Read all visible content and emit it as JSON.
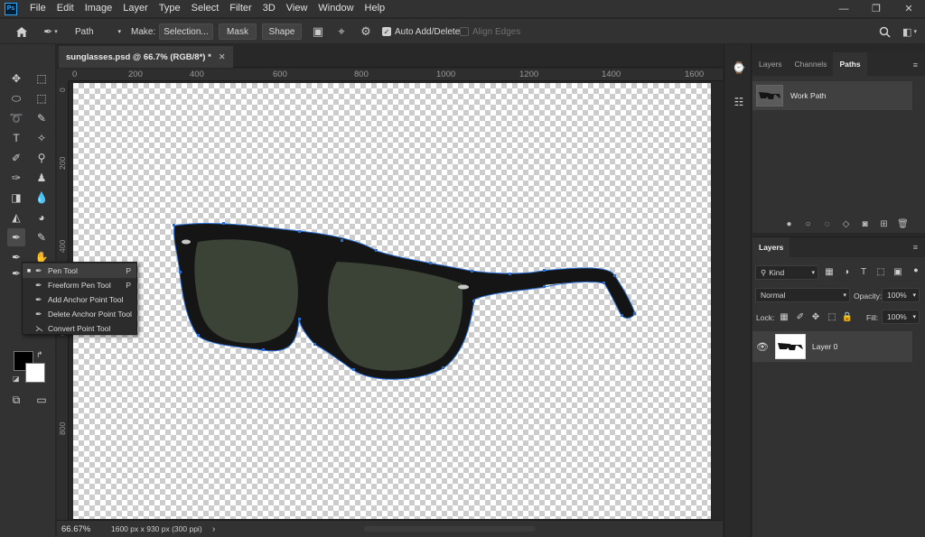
{
  "app": {
    "logo_text": "Ps"
  },
  "menu": [
    "File",
    "Edit",
    "Image",
    "Layer",
    "Type",
    "Select",
    "Filter",
    "3D",
    "View",
    "Window",
    "Help"
  ],
  "window_controls": {
    "minimize": "—",
    "restore": "❐",
    "close": "✕"
  },
  "options_bar": {
    "mode_value": "Path",
    "make_label": "Make:",
    "selection_button": "Selection...",
    "mask_button": "Mask",
    "shape_button": "Shape",
    "auto_add_delete_label": "Auto Add/Delete",
    "auto_add_delete_checked": true,
    "align_edges_label": "Align Edges",
    "align_edges_checked": false
  },
  "document": {
    "tab_title": "sunglasses.psd @ 66.7% (RGB/8*) *",
    "close_glyph": "✕",
    "ruler_top": [
      "0",
      "200",
      "400",
      "600",
      "800",
      "1000",
      "1200",
      "1400",
      "1600"
    ],
    "ruler_left": [
      "0",
      "200",
      "400",
      "600",
      "800"
    ]
  },
  "tool_flyout": {
    "items": [
      {
        "label": "Pen Tool",
        "shortcut": "P",
        "selected": true
      },
      {
        "label": "Freeform Pen Tool",
        "shortcut": "P",
        "selected": false
      },
      {
        "label": "Add Anchor Point Tool",
        "shortcut": "",
        "selected": false
      },
      {
        "label": "Delete Anchor Point Tool",
        "shortcut": "",
        "selected": false
      },
      {
        "label": "Convert Point Tool",
        "shortcut": "",
        "selected": false
      }
    ]
  },
  "status_bar": {
    "zoom": "66.67%",
    "doc_info": "1600 px x 930 px (300 ppi)",
    "arrow": "›"
  },
  "paths_panel": {
    "tabs": [
      "Layers",
      "Channels",
      "Paths"
    ],
    "active_tab": "Paths",
    "menu_glyph": "≡",
    "items": [
      {
        "name": "Work Path"
      }
    ]
  },
  "layers_panel": {
    "tab": "Layers",
    "menu_glyph": "≡",
    "filter_kind": "Kind",
    "blend_mode": "Normal",
    "opacity_label": "Opacity:",
    "opacity_value": "100%",
    "lock_label": "Lock:",
    "fill_label": "Fill:",
    "fill_value": "100%",
    "layers": [
      {
        "name": "Layer 0",
        "visible": true
      }
    ]
  },
  "colors": {
    "foreground": "#000000",
    "background": "#ffffff",
    "path_stroke": "#2a6fd6",
    "lens": "#3b4236"
  }
}
